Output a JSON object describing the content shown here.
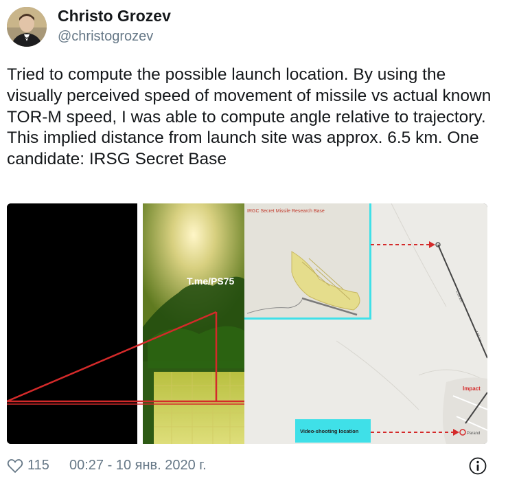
{
  "author": {
    "name": "Christo Grozev",
    "handle": "@christogrozev"
  },
  "tweet": {
    "text": "Tried to compute the possible launch location. By using the visually perceived speed of movement of missile vs actual known TOR-M speed, I was able to compute angle relative to trajectory. This implied distance from launch site was approx. 6.5 km. One candidate: IRSG Secret Base"
  },
  "media": {
    "video_watermark": "T.me/PS75",
    "map_inset_title": "IRGC Secret Missile Research Base",
    "impact_label": "Impact",
    "video_location_label": "Video-shooting location"
  },
  "footer": {
    "likes": "115",
    "timestamp": "00:27 - 10 янв. 2020 г."
  },
  "colors": {
    "accent_red": "#d42a2a",
    "cyan": "#3fe0e8",
    "muted": "#657786"
  },
  "icons": {
    "like": "heart-outline-icon",
    "info": "info-circle-icon"
  }
}
